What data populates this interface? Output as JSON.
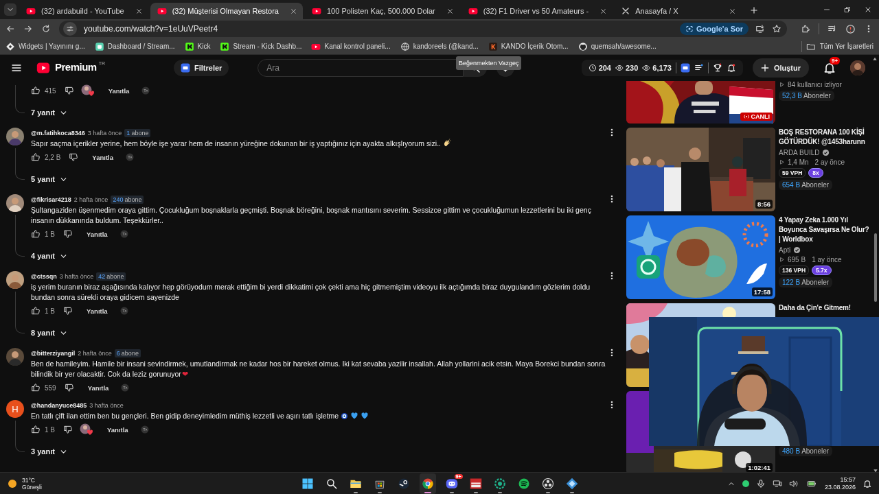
{
  "browser": {
    "tabs": [
      {
        "title": "(32) ardabuild - YouTube",
        "kind": "video",
        "selected": false
      },
      {
        "title": "(32) Müşterisi Olmayan Restora",
        "kind": "video",
        "selected": true
      },
      {
        "title": "100 Polisten Kaç, 500.000 Dolar",
        "kind": "video",
        "selected": false
      },
      {
        "title": "(32) F1 Driver vs 50 Amateurs -",
        "kind": "video",
        "selected": false
      },
      {
        "title": "Anasayfa / X",
        "kind": "social",
        "selected": false
      }
    ],
    "address": "youtube.com/watch?v=1eUuVPeetr4",
    "ask_google": "Google'a Sor",
    "bookmarks": [
      {
        "label": "Widgets | Yayınını g...",
        "kind": "widgets"
      },
      {
        "label": "Dashboard / Stream...",
        "kind": "dashboard"
      },
      {
        "label": "Kick",
        "kind": "kick"
      },
      {
        "label": "Stream - Kick Dashb...",
        "kind": "kick"
      },
      {
        "label": "Kanal kontrol paneli...",
        "kind": "video"
      },
      {
        "label": "kandoreels (@kand...",
        "kind": "globe"
      },
      {
        "label": "KANDO İçerik Otom...",
        "kind": "kando"
      },
      {
        "label": "quemsah/awesome...",
        "kind": "code"
      }
    ],
    "all_bookmarks": "Tüm Yer İşaretleri"
  },
  "header": {
    "logo_text": "Premium",
    "region": "TR",
    "filters": "Filtreler",
    "search_placeholder": "Ara",
    "tooltip": "Beğenmekten Vazgeç",
    "stats": [
      {
        "kind": "clock",
        "value": "204"
      },
      {
        "kind": "eye",
        "value": "230"
      },
      {
        "kind": "eye",
        "value": "6,173"
      }
    ],
    "create": "Oluştur",
    "notifications": "9+"
  },
  "comments": [
    {
      "likes": "415",
      "creator_heart": true,
      "reply": "Yanıtla",
      "replies": "7 yanıt"
    },
    {
      "author": "@m.fatihkoca8346",
      "time": "3 hafta önce",
      "subs_count": "1",
      "subs_label": "abone",
      "text": "Sapır saçma içerikler yerine, hem böyle işe yarar hem de insanın yüreğine dokunan bir iş yaptığınız için ayakta alkışlıyorum sizi..",
      "emojis": [
        {
          "kind": "clap"
        }
      ],
      "likes": "2,2 B",
      "creator_heart": false,
      "reply": "Yanıtla",
      "replies": "5 yanıt"
    },
    {
      "author": "@fikrisar4218",
      "time": "2 hafta önce",
      "subs_count": "240",
      "subs_label": "abone",
      "text": "Şultangaziden üşenmedim oraya gittim. Çocukluğum boşnaklarla geçmişti. Boşnak böreğini, boşnak mantısını severim. Sessizce gittim ve çocukluğumun lezzetlerini bu iki genç insanın dükkanında buldum. Teşekkürler..",
      "likes": "1 B",
      "creator_heart": false,
      "reply": "Yanıtla",
      "replies": "4 yanıt"
    },
    {
      "author": "@ctssqn",
      "time": "3 hafta önce",
      "subs_count": "42",
      "subs_label": "abone",
      "text": "iş yerim buranın biraz aşağısında kalıyor hep görüyodum merak ettiğim bi yerdi dikkatimi çok çekti ama hiç gitmemiştim videoyu ilk açtığımda biraz duygulandım gözlerim doldu bundan sonra sürekli oraya gidicem sayenizde",
      "likes": "1 B",
      "creator_heart": false,
      "reply": "Yanıtla",
      "replies": "8 yanıt"
    },
    {
      "author": "@bitterziyangil",
      "time": "2 hafta önce",
      "subs_count": "6",
      "subs_label": "abone",
      "text": "Ben de hamileyim. Hamile bir insani sevindirmek, umutlandirmak ne kadar hos bir hareket olmus. Iki kat sevaba yazilir insallah. Allah yollarini acik etsin. Maya Borekci bundan sonra bilindik bir yer olacaktir. Cok da leziz gorunuyor",
      "emojis": [
        {
          "char": "❤"
        }
      ],
      "likes": "559",
      "creator_heart": false,
      "reply": "Yanıtla"
    },
    {
      "avatar": {
        "kind": "letter",
        "letter": "H",
        "color": "#e8501c"
      },
      "author": "@handanyuce8485",
      "time": "3 hafta önce",
      "text": "En tatlı çift ilan ettim ben bu gençleri. Ben gidip deneyimledim müthiş lezzetli ve aşırı tatlı işletme",
      "emojis": [
        {
          "kind": "eye-bead"
        },
        {
          "kind": "blue-heart"
        },
        {
          "kind": "blue-heart"
        }
      ],
      "likes": "1 B",
      "creator_heart": true,
      "reply": "Yanıtla",
      "replies": "3 yanıt"
    }
  ],
  "sidebar": [
    {
      "views": "84 kullanıcı izliyor",
      "subs_count": "52,3 B",
      "subs_label": "Aboneler",
      "live_badge": "CANLI"
    },
    {
      "title": "BOŞ RESTORANA 100 KİŞİ GÖTÜRDÜK! @1453harunn",
      "channel": "ARDA BUILD",
      "verified": true,
      "views": "1,4 Mn",
      "age": "2 ay önce",
      "vph": "59 VPH",
      "multiplier": "8x",
      "subs_count": "654 B",
      "subs_label": "Aboneler",
      "duration": "8:56"
    },
    {
      "title": "4 Yapay Zeka 1.000 Yıl Boyunca Savaşırsa Ne Olur? | Worldbox",
      "channel": "Apti",
      "verified": true,
      "views": "695 B",
      "age": "1 ay önce",
      "vph": "136 VPH",
      "multiplier": "5.7x",
      "subs_count": "122 B",
      "subs_label": "Aboneler",
      "duration": "17:58"
    },
    {
      "title": "Daha da Çin'e Gitmem!"
    },
    {
      "subs_count": "480 B",
      "subs_label": "Aboneler",
      "duration": "1:02:41"
    }
  ],
  "taskbar": {
    "temperature": "31°C",
    "weather": "Güneşli",
    "apps": [
      {
        "kind": "start",
        "running": false,
        "selected": false
      },
      {
        "kind": "search",
        "running": false,
        "selected": false
      },
      {
        "kind": "folder",
        "running": true,
        "selected": false
      },
      {
        "kind": "store",
        "running": true,
        "selected": false
      },
      {
        "kind": "steam",
        "running": false,
        "selected": false
      },
      {
        "kind": "chrome",
        "running": true,
        "selected": true
      },
      {
        "kind": "discord",
        "running": true,
        "selected": false,
        "badge": "9+"
      },
      {
        "kind": "mixer",
        "running": true,
        "selected": false
      },
      {
        "kind": "ring",
        "running": true,
        "selected": false
      },
      {
        "kind": "music",
        "running": false,
        "selected": false
      },
      {
        "kind": "record",
        "running": true,
        "selected": false
      },
      {
        "kind": "diamond",
        "running": true,
        "selected": false
      }
    ],
    "time": "15:57",
    "date": "23.08.2026"
  }
}
